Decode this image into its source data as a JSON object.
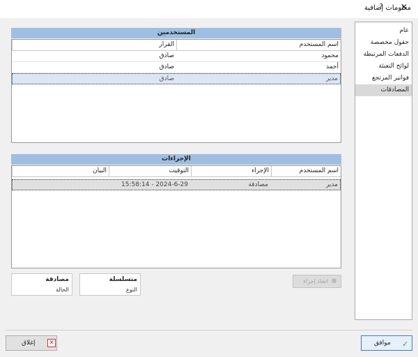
{
  "window": {
    "title": "معلومات إضافية",
    "help_glyph": "?",
    "close_glyph": "✕"
  },
  "nav": {
    "items": [
      {
        "label": "عام",
        "active": false
      },
      {
        "label": "حقول مخصصة",
        "active": false
      },
      {
        "label": "الدفعات المرتبطة",
        "active": false
      },
      {
        "label": "لوائح التعبئة",
        "active": false
      },
      {
        "label": "فواتير المرتجع",
        "active": false
      },
      {
        "label": "المصادقات",
        "active": true
      }
    ]
  },
  "users": {
    "header": "المستخدمين",
    "columns": {
      "name": "اسم المستخدم",
      "decision": "القرار"
    },
    "rows": [
      {
        "name": "محمود",
        "decision": "صادق"
      },
      {
        "name": "أحمد",
        "decision": "صادق"
      },
      {
        "name": "مدير",
        "decision": "صادق"
      }
    ]
  },
  "actions": {
    "header": "الإجراءات",
    "columns": {
      "user": "اسم المستخدم",
      "action": "الإجراء",
      "time": "التوقيت",
      "description": "البيان"
    },
    "rows": [
      {
        "user": "مدير",
        "action": "مصادقة",
        "time": "15:58:14 - 2024-6-29",
        "description": ""
      }
    ]
  },
  "cards": {
    "type": {
      "title": "متسلسلة",
      "subtitle": "النوع"
    },
    "status": {
      "title": "مصادقة",
      "subtitle": "الحالة"
    }
  },
  "buttons": {
    "take_action": "اتخاذ إجراء",
    "ok": "موافق",
    "close": "إغلاق"
  },
  "icons": {
    "take_action": "person-icon",
    "ok": "checkmark-icon",
    "close": "close-box-icon"
  }
}
